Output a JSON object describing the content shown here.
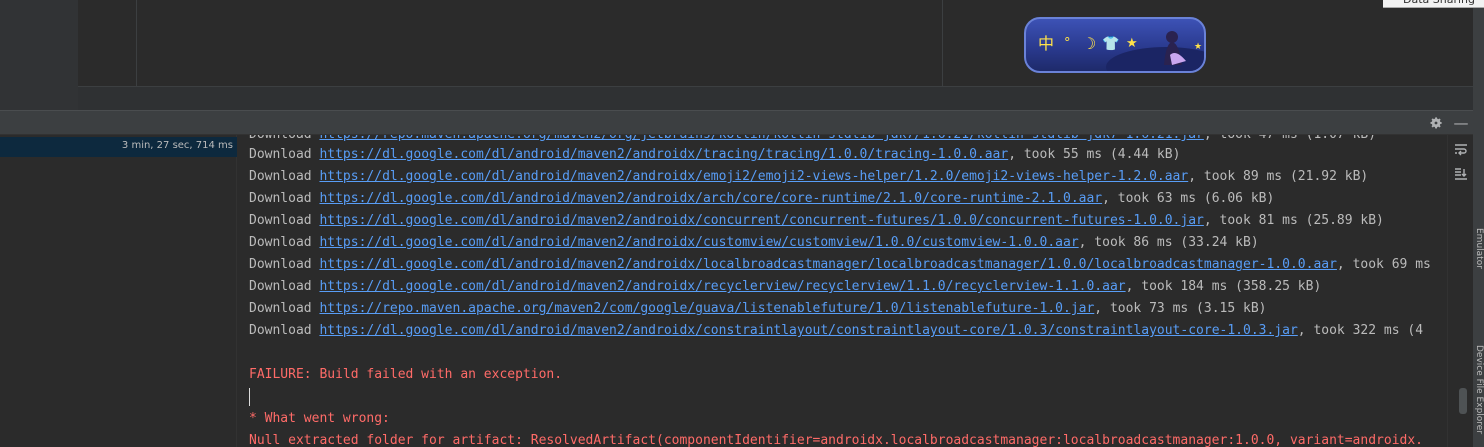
{
  "top": {
    "data_sharing_label": "Data Sharing"
  },
  "skin_widget": {
    "glyphs": [
      "中",
      "°",
      "☽",
      "👕",
      "★",
      "★"
    ]
  },
  "header": {
    "settings_icon": "gear-icon",
    "minimize_icon": "minus-icon",
    "minimize_glyph": "—"
  },
  "tree": {
    "selected_time": "3 min, 27 sec, 714 ms"
  },
  "console": {
    "lines": [
      {
        "prefix": "Download ",
        "url": "https://dl.google.com/dl/android/maven2/androidx/tracing/tracing/1.0.0/tracing-1.0.0.aar",
        "suffix": ", took 55 ms (4.44 kB)"
      },
      {
        "prefix": "Download ",
        "url": "https://dl.google.com/dl/android/maven2/androidx/emoji2/emoji2-views-helper/1.2.0/emoji2-views-helper-1.2.0.aar",
        "suffix": ", took 89 ms (21.92 kB)"
      },
      {
        "prefix": "Download ",
        "url": "https://dl.google.com/dl/android/maven2/androidx/arch/core/core-runtime/2.1.0/core-runtime-2.1.0.aar",
        "suffix": ", took 63 ms (6.06 kB)"
      },
      {
        "prefix": "Download ",
        "url": "https://dl.google.com/dl/android/maven2/androidx/concurrent/concurrent-futures/1.0.0/concurrent-futures-1.0.0.jar",
        "suffix": ", took 81 ms (25.89 kB)"
      },
      {
        "prefix": "Download ",
        "url": "https://dl.google.com/dl/android/maven2/androidx/customview/customview/1.0.0/customview-1.0.0.aar",
        "suffix": ", took 86 ms (33.24 kB)"
      },
      {
        "prefix": "Download ",
        "url": "https://dl.google.com/dl/android/maven2/androidx/localbroadcastmanager/localbroadcastmanager/1.0.0/localbroadcastmanager-1.0.0.aar",
        "suffix": ", took 69 ms"
      },
      {
        "prefix": "Download ",
        "url": "https://dl.google.com/dl/android/maven2/androidx/recyclerview/recyclerview/1.1.0/recyclerview-1.1.0.aar",
        "suffix": ", took 184 ms (358.25 kB)"
      },
      {
        "prefix": "Download ",
        "url": "https://repo.maven.apache.org/maven2/com/google/guava/listenablefuture/1.0/listenablefuture-1.0.jar",
        "suffix": ", took 73 ms (3.15 kB)"
      },
      {
        "prefix": "Download ",
        "url": "https://dl.google.com/dl/android/maven2/androidx/constraintlayout/constraintlayout-core/1.0.3/constraintlayout-core-1.0.3.jar",
        "suffix": ", took 322 ms (4"
      }
    ],
    "failure": "FAILURE: Build failed with an exception.",
    "what_went_wrong": "* What went wrong:",
    "error_detail": "Null extracted folder for artifact: ResolvedArtifact(componentIdentifier=androidx.localbroadcastmanager:localbroadcastmanager:1.0.0, variant=androidx."
  },
  "gutter": {
    "soft_wrap_icon": "soft-wrap-icon",
    "scroll_to_end_icon": "scroll-to-end-icon"
  },
  "side_tabs": {
    "tab_a": "Emulator",
    "tab_b": "Device File Explorer"
  },
  "colors": {
    "background": "#2b2b2b",
    "link": "#589df6",
    "error": "#ff6b68",
    "text": "#bbbbbb",
    "selection": "#0d293e"
  }
}
